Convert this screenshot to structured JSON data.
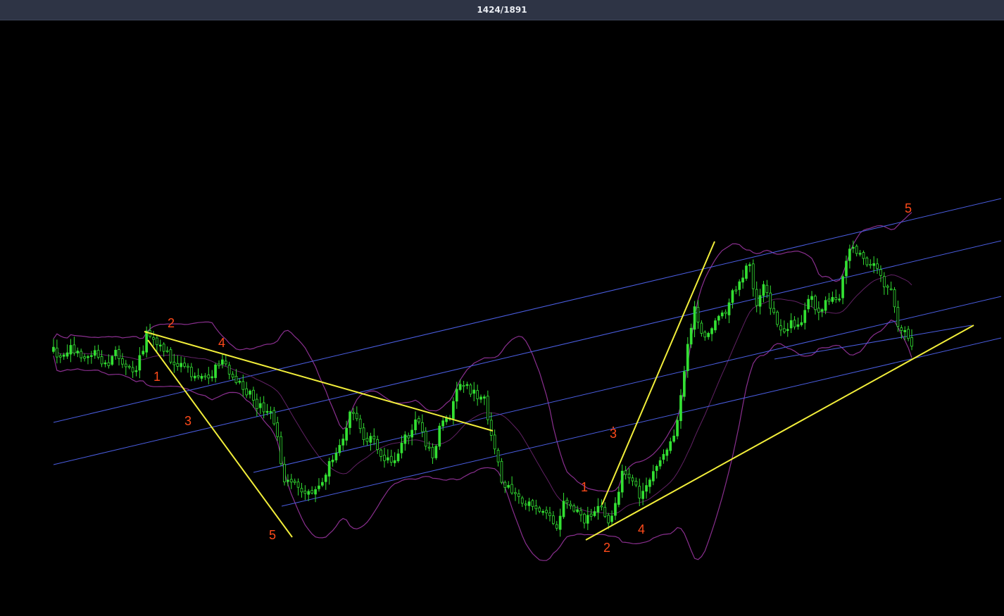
{
  "window": {
    "counter": "1424/1891"
  },
  "colors": {
    "background": "#000000",
    "bull_candle": "#33e033",
    "bear_candle": "#33e033",
    "band": "#8a2f8f",
    "channel": "#4a5de0",
    "trendline": "#f2ee3a",
    "wave_label": "#ff4a1a"
  },
  "chart_data": {
    "type": "candlestick",
    "title": "",
    "xlabel": "",
    "ylabel": "",
    "grid": false,
    "legend": "none",
    "overlays": [
      "bollinger-bands",
      "regression-channel",
      "trendlines",
      "elliott-wave-labels"
    ],
    "wave_labels": [
      {
        "text": "1",
        "bar": 30
      },
      {
        "text": "2",
        "bar": 33
      },
      {
        "text": "3",
        "bar": 39
      },
      {
        "text": "4",
        "bar": 54
      },
      {
        "text": "5",
        "bar": 65
      },
      {
        "text": "1",
        "bar": 161
      },
      {
        "text": "2",
        "bar": 164
      },
      {
        "text": ".",
        "bar": 167
      },
      {
        "text": "3",
        "bar": 167
      },
      {
        "text": "4",
        "bar": 171
      },
      {
        "text": "5",
        "bar": 242
      }
    ]
  }
}
